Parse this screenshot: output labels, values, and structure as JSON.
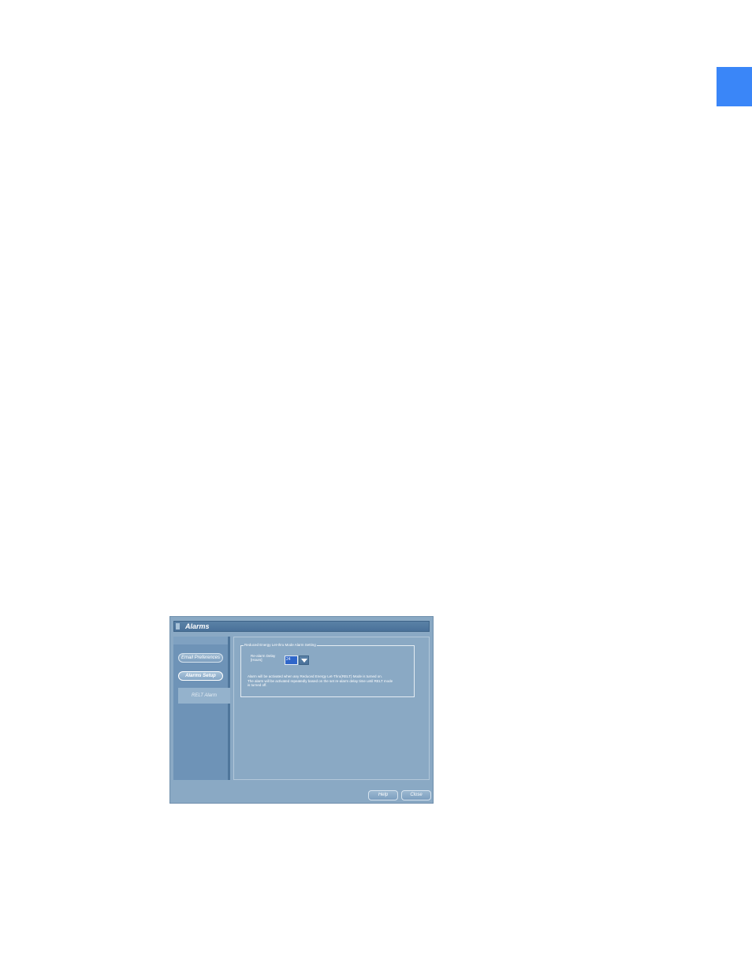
{
  "colors": {
    "corner_tab": "#3a86f8",
    "window_bg": "#8aa9c4",
    "titlebar": "#4a7199",
    "selected_value": "#2f66c9"
  },
  "window": {
    "title": "Alarms"
  },
  "sidebar": {
    "items": [
      {
        "label": "Email Preferences",
        "active": false
      },
      {
        "label": "Alarms Setup",
        "active": true
      }
    ],
    "sub_item": "RELT Alarm"
  },
  "content": {
    "group_title": "Reduced Energy Let-thru Mode Alarm Setting",
    "field_label_line1": "Re-alarm Delay",
    "field_label_line2": "[Hours]",
    "select_value": "24",
    "note_line1": "Alarm will be activated when any Reduced Energy Let-Thru(RELT) Mode is turned on.",
    "note_line2": "The alarm will be activated repeatedly based on the set re-alarm delay time until RELT mode",
    "note_line3": "is turned off."
  },
  "footer": {
    "help_label": "Help",
    "close_label": "Close"
  },
  "icons": {
    "dropdown": "chevron-down-icon"
  }
}
